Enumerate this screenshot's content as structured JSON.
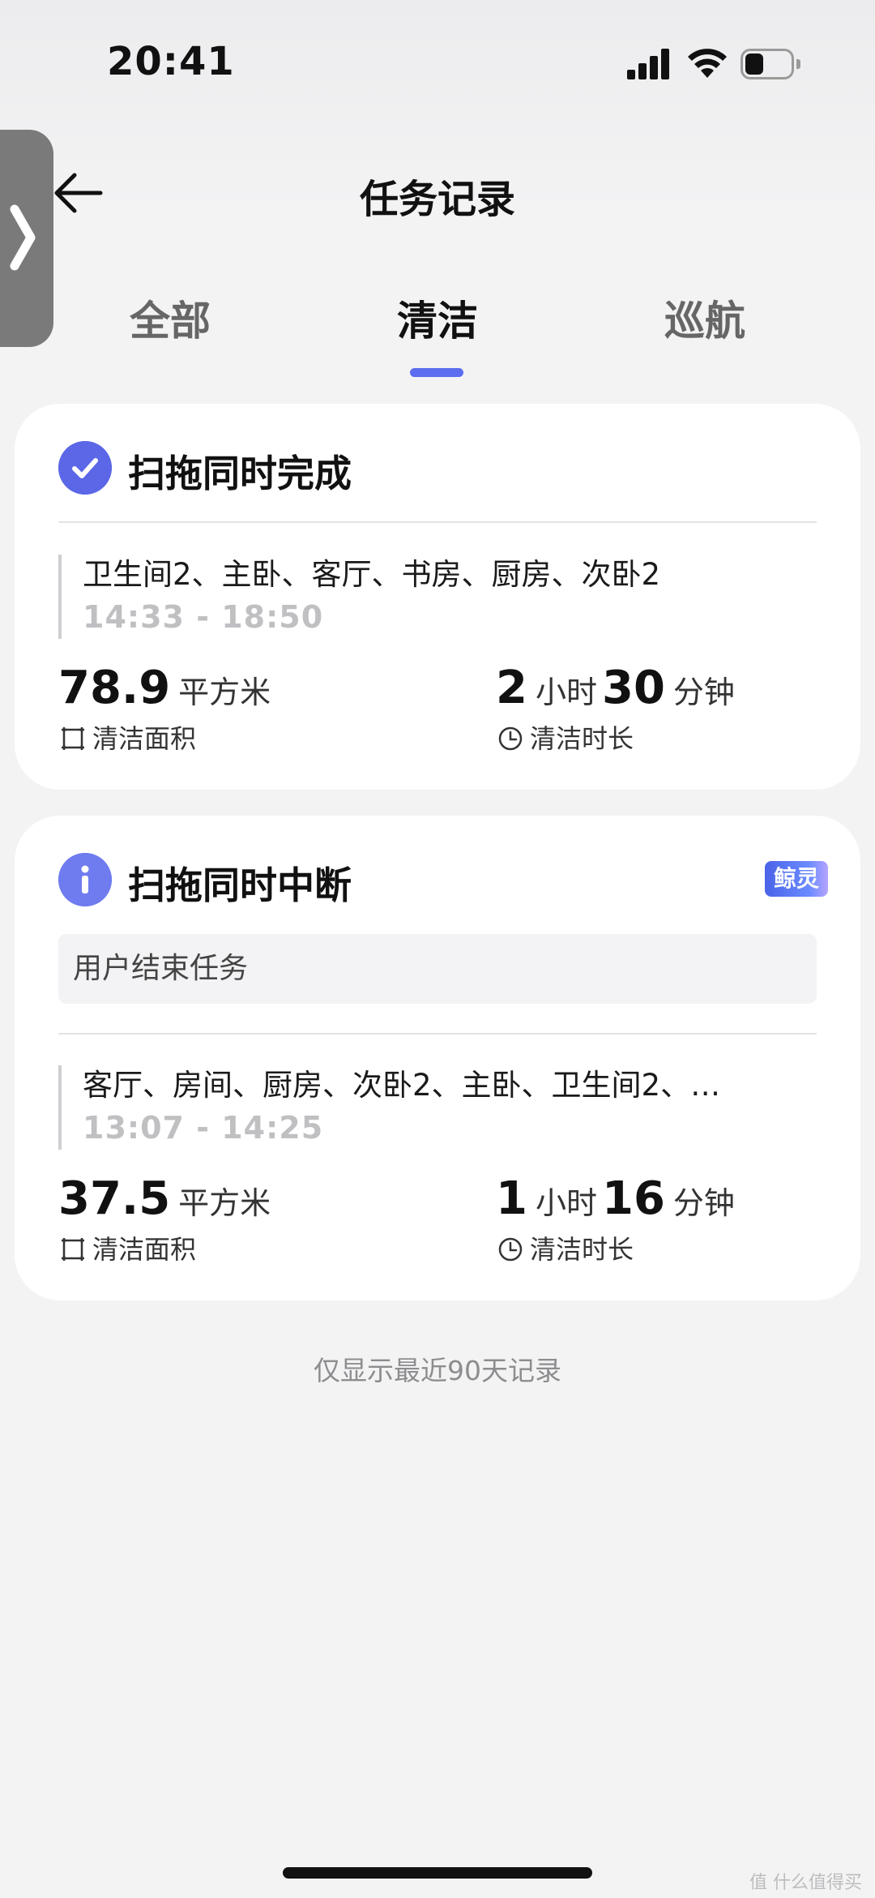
{
  "status_bar": {
    "time": "20:41"
  },
  "header": {
    "title": "任务记录"
  },
  "tabs": [
    {
      "label": "全部",
      "active": false
    },
    {
      "label": "清洁",
      "active": true
    },
    {
      "label": "巡航",
      "active": false
    }
  ],
  "records": [
    {
      "status": "complete",
      "icon": "check-icon",
      "title": "扫拖同时完成",
      "rooms": "卫生间2、主卧、客厅、书房、厨房、次卧2",
      "time_range": "14:33 - 18:50",
      "area_value": "78.9",
      "area_unit": "平方米",
      "area_label": "清洁面积",
      "duration_hours": "2",
      "hours_unit": "小时",
      "duration_minutes": "30",
      "minutes_unit": "分钟",
      "duration_label": "清洁时长"
    },
    {
      "status": "interrupted",
      "icon": "info-icon",
      "title": "扫拖同时中断",
      "badge": "鲸灵",
      "reason": "用户结束任务",
      "rooms": "客厅、房间、厨房、次卧2、主卧、卫生间2、…",
      "time_range": "13:07 - 14:25",
      "area_value": "37.5",
      "area_unit": "平方米",
      "area_label": "清洁面积",
      "duration_hours": "1",
      "hours_unit": "小时",
      "duration_minutes": "16",
      "minutes_unit": "分钟",
      "duration_label": "清洁时长"
    }
  ],
  "footer": {
    "note": "仅显示最近90天记录"
  },
  "watermark": "值 什么值得买",
  "colors": {
    "accent": "#5c6df0",
    "icon_blue": "#5b67e6",
    "badge": "#4b63e8"
  }
}
